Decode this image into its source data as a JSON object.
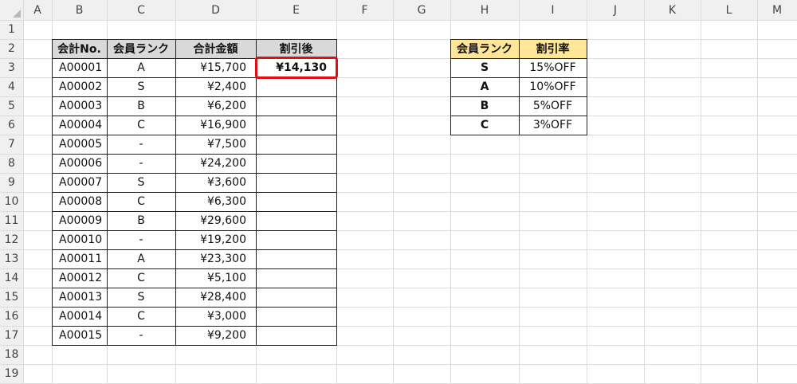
{
  "colors": {
    "grid": "#dcdcdc",
    "header_bg": "#f0f0f0",
    "table_header_gray": "#d9d9d9",
    "table_header_yellow": "#ffe699",
    "selection": "#e01010",
    "border": "#222222"
  },
  "sheet": {
    "columns": [
      "A",
      "B",
      "C",
      "D",
      "E",
      "F",
      "G",
      "H",
      "I",
      "J",
      "K",
      "L",
      "M"
    ],
    "rows": [
      "1",
      "2",
      "3",
      "4",
      "5",
      "6",
      "7",
      "8",
      "9",
      "10",
      "11",
      "12",
      "13",
      "14",
      "15",
      "16",
      "17",
      "18",
      "19"
    ]
  },
  "main_table": {
    "headers": [
      "会計No.",
      "会員ランク",
      "合計金額",
      "割引後"
    ],
    "rows": [
      [
        "A00001",
        "A",
        "¥15,700",
        "¥14,130"
      ],
      [
        "A00002",
        "S",
        "¥2,400",
        ""
      ],
      [
        "A00003",
        "B",
        "¥6,200",
        ""
      ],
      [
        "A00004",
        "C",
        "¥16,900",
        ""
      ],
      [
        "A00005",
        "-",
        "¥7,500",
        ""
      ],
      [
        "A00006",
        "-",
        "¥24,200",
        ""
      ],
      [
        "A00007",
        "S",
        "¥3,600",
        ""
      ],
      [
        "A00008",
        "C",
        "¥6,300",
        ""
      ],
      [
        "A00009",
        "B",
        "¥29,600",
        ""
      ],
      [
        "A00010",
        "-",
        "¥19,200",
        ""
      ],
      [
        "A00011",
        "A",
        "¥23,300",
        ""
      ],
      [
        "A00012",
        "C",
        "¥5,100",
        ""
      ],
      [
        "A00013",
        "S",
        "¥28,400",
        ""
      ],
      [
        "A00014",
        "C",
        "¥3,000",
        ""
      ],
      [
        "A00015",
        "-",
        "¥9,200",
        ""
      ]
    ]
  },
  "discount_table": {
    "headers": [
      "会員ランク",
      "割引率"
    ],
    "rows": [
      [
        "S",
        "15%OFF"
      ],
      [
        "A",
        "10%OFF"
      ],
      [
        "B",
        "5%OFF"
      ],
      [
        "C",
        "3%OFF"
      ]
    ]
  },
  "selected_cell": "E3"
}
